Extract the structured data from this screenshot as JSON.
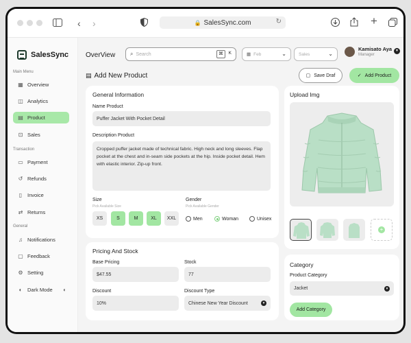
{
  "browser": {
    "url": "SalesSync.com"
  },
  "app": {
    "name": "SalesSync"
  },
  "sidebar": {
    "sections": [
      {
        "label": "Main Menu"
      },
      {
        "label": "Transaction"
      },
      {
        "label": "General"
      }
    ],
    "items": [
      {
        "label": "Overview",
        "icon": "grid-icon"
      },
      {
        "label": "Analytics",
        "icon": "chart-icon"
      },
      {
        "label": "Product",
        "icon": "box-icon",
        "active": true
      },
      {
        "label": "Sales",
        "icon": "cart-icon"
      },
      {
        "label": "Payment",
        "icon": "wallet-icon"
      },
      {
        "label": "Refunds",
        "icon": "refund-icon"
      },
      {
        "label": "Invoice",
        "icon": "invoice-icon"
      },
      {
        "label": "Returns",
        "icon": "return-icon"
      },
      {
        "label": "Notifications",
        "icon": "bell-icon"
      },
      {
        "label": "Feedback",
        "icon": "chat-icon"
      },
      {
        "label": "Setting",
        "icon": "gear-icon"
      },
      {
        "label": "Dark Mode",
        "icon": "moon-icon"
      }
    ]
  },
  "header": {
    "title": "OverView",
    "search_placeholder": "Search",
    "shortcut": [
      "⌘",
      "K"
    ],
    "date_filter": "Feb",
    "sales_filter": "Sales",
    "user": {
      "name": "Kamisato Aya",
      "role": "Manager"
    }
  },
  "page": {
    "title": "Add New Product",
    "save_draft": "Save Draf",
    "add_product": "Add Product"
  },
  "general": {
    "title": "General Information",
    "name_label": "Name Product",
    "name_value": "Puffer Jacket With Pocket Detail",
    "desc_label": "Description Product",
    "desc_value": "Cropped puffer jacket made of technical fabric. High neck and long sleeves. Flap pocket at the chest and in-seam side pockets at the hip. Inside pocket detail. Hem with elastic interior. Zip-up front.",
    "size_label": "Size",
    "size_hint": "Pick Available Size",
    "sizes": [
      {
        "label": "XS",
        "selected": false
      },
      {
        "label": "S",
        "selected": true
      },
      {
        "label": "M",
        "selected": true
      },
      {
        "label": "XL",
        "selected": true
      },
      {
        "label": "XXL",
        "selected": false
      }
    ],
    "gender_label": "Gender",
    "gender_hint": "Pick Available Gender",
    "genders": [
      {
        "label": "Men",
        "selected": false
      },
      {
        "label": "Woman",
        "selected": true
      },
      {
        "label": "Unisex",
        "selected": false
      }
    ]
  },
  "pricing": {
    "title": "Pricing And Stock",
    "base_label": "Base Pricing",
    "base_value": "$47.55",
    "stock_label": "Stock",
    "stock_value": "77",
    "discount_label": "Discount",
    "discount_value": "10%",
    "discount_type_label": "Discount Type",
    "discount_type_value": "Chinese New Year Discount"
  },
  "upload": {
    "title": "Upload Img"
  },
  "category": {
    "title": "Category",
    "label": "Product Category",
    "value": "Jacket",
    "button": "Add Category"
  },
  "colors": {
    "accent": "#a2e6a2",
    "active_nav": "#a8e8a8",
    "jacket": "#b9dfc6"
  }
}
